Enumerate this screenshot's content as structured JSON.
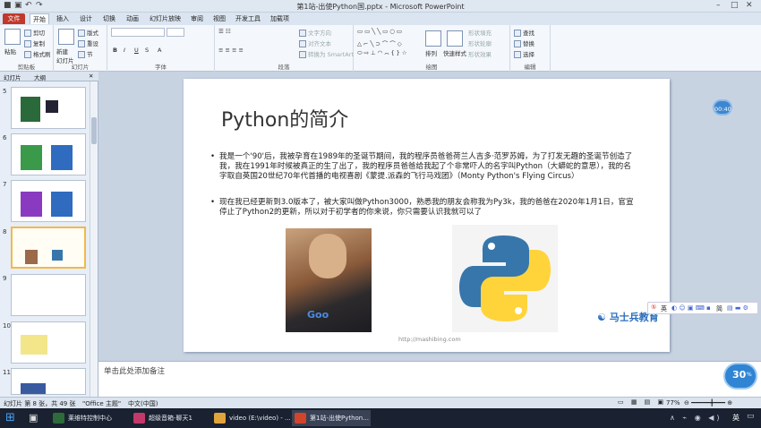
{
  "titlebar": {
    "title": "第1站-出使Python国.pptx - Microsoft PowerPoint"
  },
  "tabs": [
    "开始",
    "插入",
    "设计",
    "切换",
    "动画",
    "幻灯片放映",
    "审阅",
    "视图",
    "开发工具",
    "加载项"
  ],
  "file_tab": "文件",
  "ribbon": {
    "clipboard": {
      "paste": "粘贴",
      "cut": "剪切",
      "copy": "复制",
      "format_painter": "格式刷",
      "label": "剪贴板"
    },
    "slides": {
      "new_slide": "新建\n幻灯片",
      "layout": "版式",
      "reset": "重设",
      "section": "节",
      "label": "幻灯片"
    },
    "font": {
      "label": "字体"
    },
    "paragraph": {
      "text_direction": "文字方向",
      "align_text": "对齐文本",
      "smartart": "转换为 SmartArt",
      "label": "段落"
    },
    "drawing": {
      "arrange": "排列",
      "quick_styles": "快速样式",
      "shape_fill": "形状填充",
      "shape_outline": "形状轮廓",
      "shape_effects": "形状效果",
      "label": "绘图"
    },
    "editing": {
      "find": "查找",
      "replace": "替换",
      "select": "选择",
      "label": "编辑"
    }
  },
  "left_pane": {
    "tab_slides": "幻灯片",
    "tab_outline": "大纲",
    "thumbnails": [
      {
        "num": "5"
      },
      {
        "num": "6"
      },
      {
        "num": "7"
      },
      {
        "num": "8",
        "selected": true
      },
      {
        "num": "9"
      },
      {
        "num": "10"
      },
      {
        "num": "11"
      }
    ]
  },
  "slide": {
    "title": "Python的简介",
    "bullets": [
      "我是一个'90'后，我被孕育在1989年的圣诞节期间，我的程序员爸爸荷兰人吉多·范罗苏姆，为了打发无趣的圣诞节创造了我，我在1991年时候被真正的生了出了，我的程序员爸爸给我起了个非常吓人的名字叫Python（大蟒蛇的意思），我的名字取自英国20世纪70年代首播的电视喜剧《蒙提.派森的飞行马戏团》（Monty Python's Flying Circus）",
      "现在我已经更新到3.0版本了，被大家叫做Python3000，熟悉我的朋友会称我为Py3k，我的爸爸在2020年1月1日，官宣停止了Python2的更新，所以对于初学者的你来说，你只需要认识我就可以了"
    ],
    "url": "http://mashibing.com",
    "brand": "马士兵教育"
  },
  "notes_placeholder": "单击此处添加备注",
  "statusbar": {
    "slide_info": "幻灯片 第 8 张，共 49 张",
    "theme": "\"Office 主题\"",
    "language": "中文(中国)",
    "zoom": "77%"
  },
  "overlays": {
    "timer": "00:40",
    "speed": "30",
    "speed_unit": "%",
    "ime_lang": "英",
    "ime_mode": "简"
  },
  "taskbar": {
    "items": [
      "莱维特控制中心",
      "超级音箱-聊天1",
      "video (E:\\video) - ...",
      "第1站-出使Python..."
    ],
    "tray_lang": "英"
  },
  "colors": {
    "accent_file": "#c0392b",
    "python_blue": "#3776ab",
    "python_yellow": "#ffd43b"
  }
}
